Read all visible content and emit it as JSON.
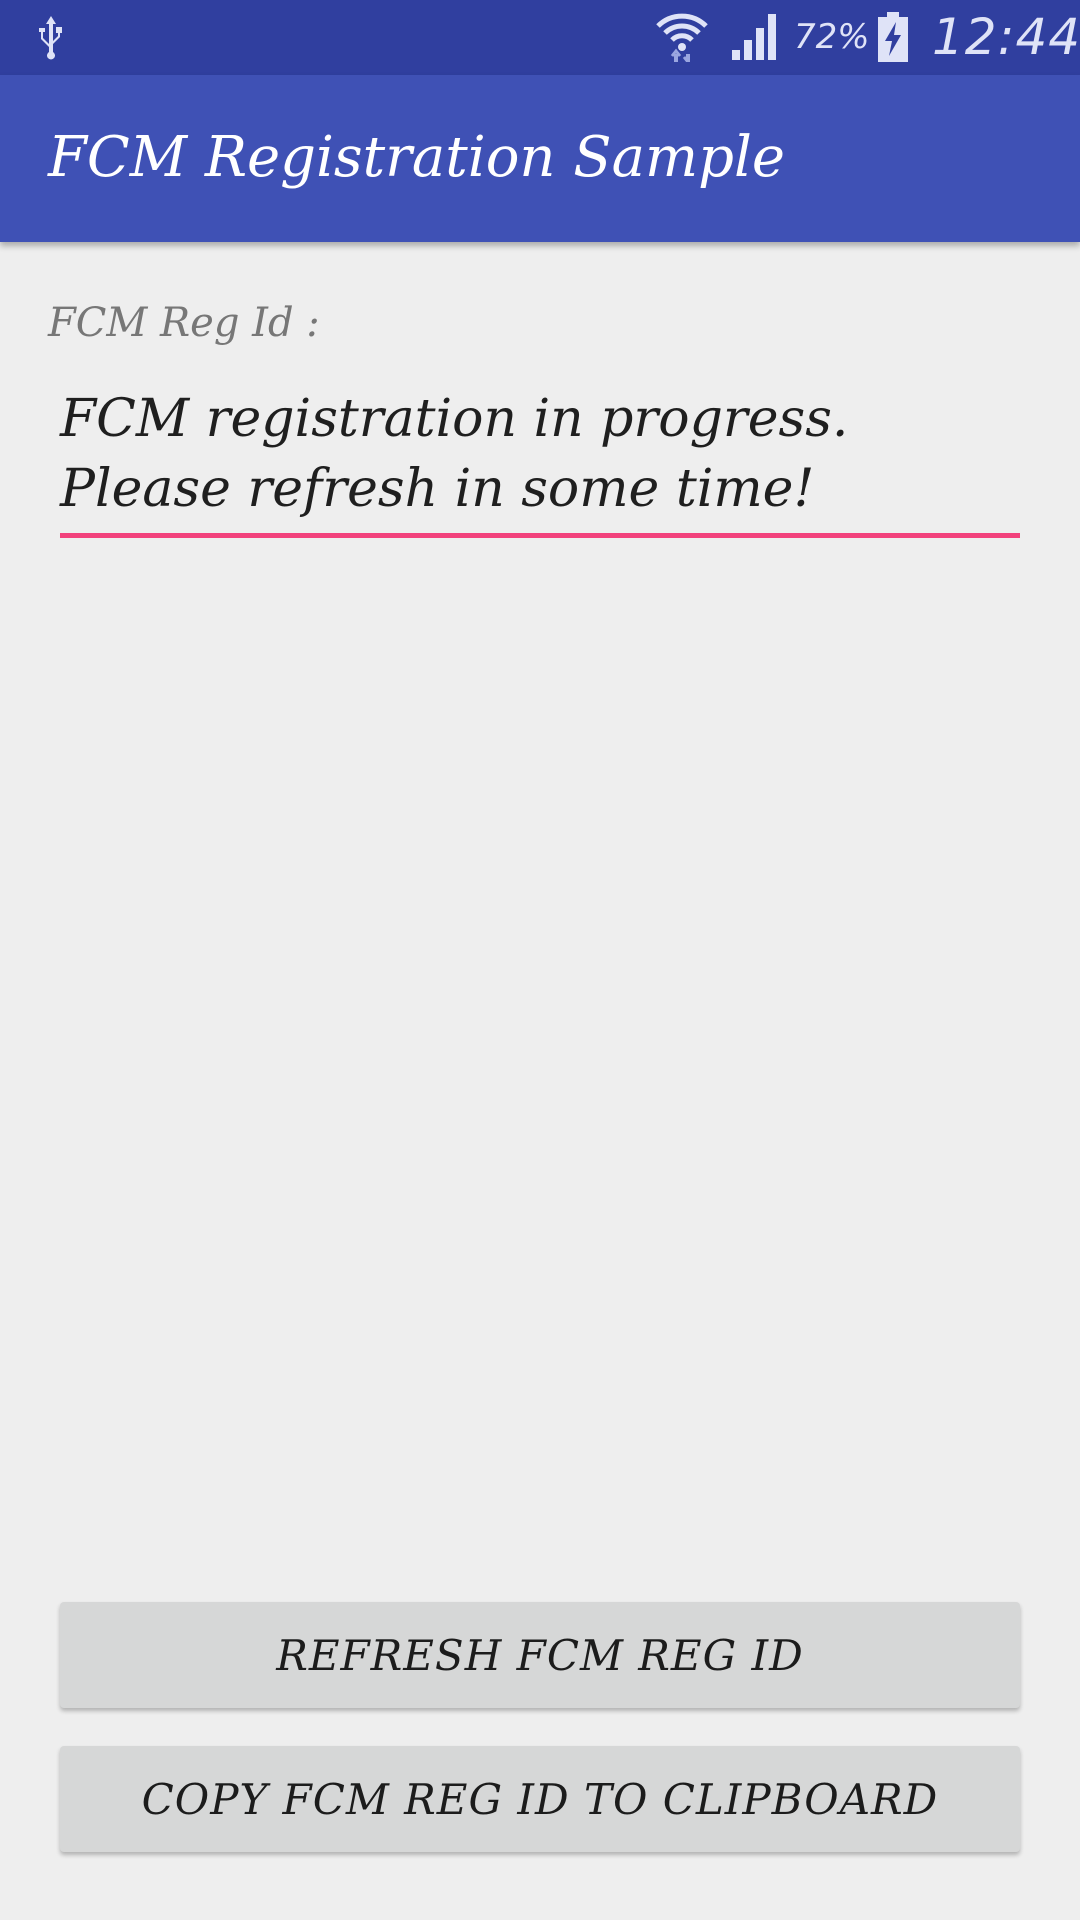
{
  "status_bar": {
    "left_icon": "usb-icon",
    "wifi_icon": "wifi-icon",
    "signal_icon": "signal-icon",
    "battery_percent": "72%",
    "battery_icon": "battery-charging-icon",
    "time": "12:44"
  },
  "app_bar": {
    "title": "FCM Registration Sample"
  },
  "content": {
    "reg_label": "FCM Reg Id :",
    "reg_value": "FCM registration in progress. Please refresh in some time!"
  },
  "buttons": {
    "refresh_label": "REFRESH FCM REG ID",
    "copy_label": "COPY FCM REG ID TO CLIPBOARD"
  },
  "colors": {
    "status_bar": "#303f9f",
    "app_bar": "#3f51b5",
    "accent_underline": "#f2417c",
    "background": "#eeeeee",
    "button_bg": "#d6d7d7"
  }
}
